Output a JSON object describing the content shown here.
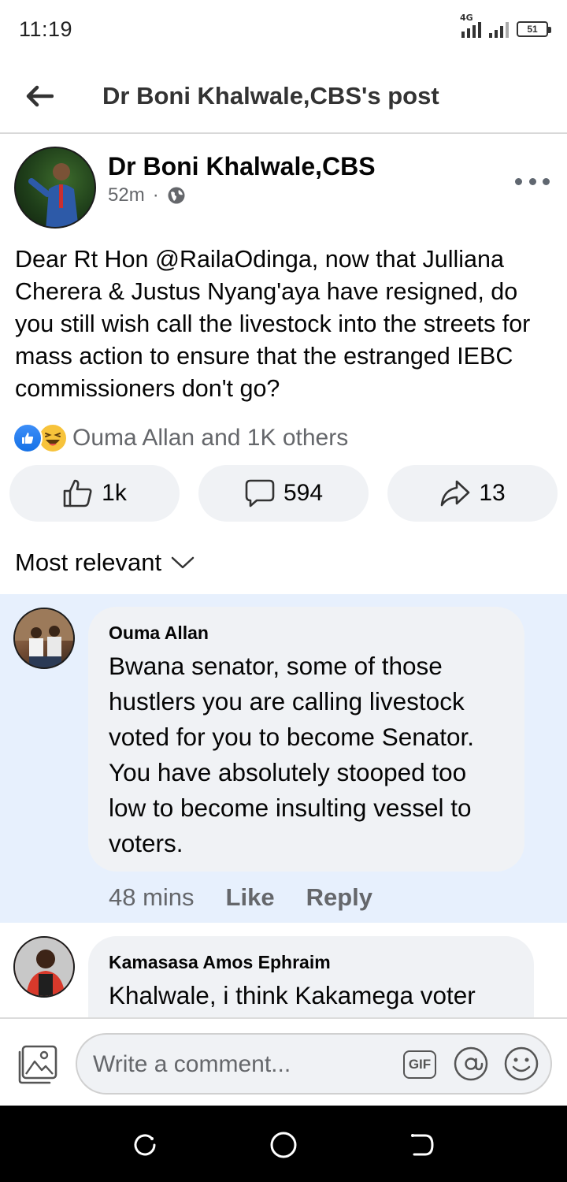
{
  "status_bar": {
    "time": "11:19",
    "network": "4G",
    "battery": "51"
  },
  "header": {
    "title": "Dr Boni Khalwale,CBS's post",
    "back_icon": "arrow-left-icon"
  },
  "post": {
    "author": "Dr Boni Khalwale,CBS",
    "time": "52m",
    "separator": "·",
    "audience_icon": "globe-icon",
    "text": "Dear Rt Hon @RailaOdinga, now that Julliana Cherera & Justus Nyang'aya have resigned, do you still wish call the livestock into the streets for mass action to ensure that the estranged IEBC commissioners don't go?",
    "reactions_text": "Ouma Allan and 1K others",
    "actions": {
      "like_count": "1k",
      "comment_count": "594",
      "share_count": "13"
    }
  },
  "sort": {
    "label": "Most relevant"
  },
  "comments": [
    {
      "author": "Ouma Allan",
      "text": "Bwana senator, some of those hustlers you are calling livestock voted for you to become Senator. You have absolutely stooped too low to become insulting vessel to voters.",
      "time": "48 mins",
      "like_label": "Like",
      "reply_label": "Reply"
    },
    {
      "author": "Kamasasa Amos Ephraim",
      "text": "Khalwale, i think Kakamega voter"
    }
  ],
  "composer": {
    "placeholder": "Write a comment...",
    "gif_label": "GIF"
  },
  "colors": {
    "accent_blue": "#1877f2",
    "highlight_bg": "#e7f0fd",
    "bubble_bg": "#f0f2f5",
    "secondary_text": "#65676b"
  }
}
